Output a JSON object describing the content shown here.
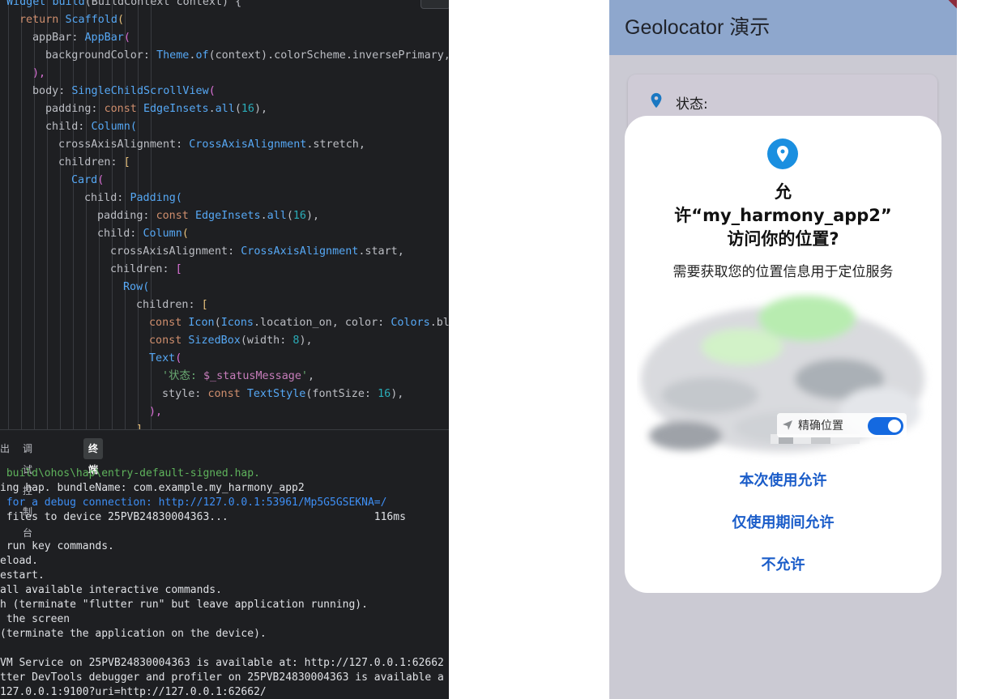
{
  "editor": {
    "lines": [
      [
        [
          "tok-cls",
          "Widget "
        ],
        [
          "tok-fn",
          "build"
        ],
        [
          "",
          "(BuildContext context) {"
        ]
      ],
      [
        [
          "tok-kw",
          "return "
        ],
        [
          "tok-cls",
          "Scaffold"
        ],
        [
          "tok-br1",
          "("
        ]
      ],
      [
        [
          "",
          "appBar: "
        ],
        [
          "tok-cls",
          "AppBar"
        ],
        [
          "tok-br2",
          "("
        ]
      ],
      [
        [
          "",
          "backgroundColor: "
        ],
        [
          "tok-cls",
          "Theme"
        ],
        [
          "",
          "."
        ],
        [
          "tok-fn",
          "of"
        ],
        [
          "",
          "(context).colorScheme.inversePrimary,"
        ]
      ],
      [
        [
          "tok-br2",
          "),"
        ]
      ],
      [
        [
          "",
          "body: "
        ],
        [
          "tok-cls",
          "SingleChildScrollView"
        ],
        [
          "tok-br2",
          "("
        ]
      ],
      [
        [
          "",
          "padding: "
        ],
        [
          "tok-kw",
          "const "
        ],
        [
          "tok-cls",
          "EdgeInsets"
        ],
        [
          "",
          "."
        ],
        [
          "tok-fn",
          "all"
        ],
        [
          "",
          "("
        ],
        [
          "tok-num",
          "16"
        ],
        [
          "",
          "),"
        ]
      ],
      [
        [
          "",
          "child: "
        ],
        [
          "tok-cls",
          "Column"
        ],
        [
          "tok-br3",
          "("
        ]
      ],
      [
        [
          "",
          "crossAxisAlignment: "
        ],
        [
          "tok-cls",
          "CrossAxisAlignment"
        ],
        [
          "",
          ".stretch,"
        ]
      ],
      [
        [
          "",
          "children: "
        ],
        [
          "tok-br1",
          "["
        ]
      ],
      [
        [
          "tok-cls",
          "Card"
        ],
        [
          "tok-br2",
          "("
        ]
      ],
      [
        [
          "",
          "child: "
        ],
        [
          "tok-cls",
          "Padding"
        ],
        [
          "tok-br3",
          "("
        ]
      ],
      [
        [
          "",
          "padding: "
        ],
        [
          "tok-kw",
          "const "
        ],
        [
          "tok-cls",
          "EdgeInsets"
        ],
        [
          "",
          "."
        ],
        [
          "tok-fn",
          "all"
        ],
        [
          "",
          "("
        ],
        [
          "tok-num",
          "16"
        ],
        [
          "",
          "),"
        ]
      ],
      [
        [
          "",
          "child: "
        ],
        [
          "tok-cls",
          "Column"
        ],
        [
          "tok-br1",
          "("
        ]
      ],
      [
        [
          "",
          "crossAxisAlignment: "
        ],
        [
          "tok-cls",
          "CrossAxisAlignment"
        ],
        [
          "",
          ".start,"
        ]
      ],
      [
        [
          "",
          "children: "
        ],
        [
          "tok-br2",
          "["
        ]
      ],
      [
        [
          "tok-cls",
          "Row"
        ],
        [
          "tok-br3",
          "("
        ]
      ],
      [
        [
          "",
          "children: "
        ],
        [
          "tok-br1",
          "["
        ]
      ],
      [
        [
          "tok-kw",
          "const "
        ],
        [
          "tok-cls",
          "Icon"
        ],
        [
          "",
          "("
        ],
        [
          "tok-cls",
          "Icons"
        ],
        [
          "",
          ".location_on, color: "
        ],
        [
          "tok-cls",
          "Colors"
        ],
        [
          "",
          ".blue"
        ]
      ],
      [
        [
          "tok-kw",
          "const "
        ],
        [
          "tok-cls",
          "SizedBox"
        ],
        [
          "",
          "(width: "
        ],
        [
          "tok-num",
          "8"
        ],
        [
          "",
          "),"
        ]
      ],
      [
        [
          "tok-cls",
          "Text"
        ],
        [
          "tok-br2",
          "("
        ]
      ],
      [
        [
          "tok-str",
          "'状态: "
        ],
        [
          "tok-var",
          "$_statusMessage"
        ],
        [
          "tok-str",
          "'"
        ],
        [
          "",
          ","
        ]
      ],
      [
        [
          "",
          "style: "
        ],
        [
          "tok-kw",
          "const "
        ],
        [
          "tok-cls",
          "TextStyle"
        ],
        [
          "",
          "(fontSize: "
        ],
        [
          "tok-num",
          "16"
        ],
        [
          "",
          "),"
        ]
      ],
      [
        [
          "tok-br2",
          "),"
        ]
      ],
      [
        [
          "tok-br1",
          "],"
        ]
      ]
    ]
  },
  "panel": {
    "tabs": [
      "出",
      "调试控制台",
      "终端"
    ],
    "active_tab": "终端",
    "terminal": [
      {
        "cls": "term-green",
        "text": " build\\ohos\\hap\\entry-default-signed.hap."
      },
      {
        "cls": "",
        "text": "ing hap. bundleName: com.example.my_harmony_app2"
      },
      {
        "cls": "term-blue",
        "text": " for a debug connection: http://127.0.0.1:53961/Mp5G5GSEKNA=/"
      },
      {
        "cls": "",
        "text": " files to device 25PVB24830004363...                       116ms"
      },
      {
        "cls": "",
        "text": ""
      },
      {
        "cls": "",
        "text": " run key commands."
      },
      {
        "cls": "",
        "text": "eload."
      },
      {
        "cls": "",
        "text": "estart."
      },
      {
        "cls": "",
        "text": "all available interactive commands."
      },
      {
        "cls": "",
        "text": "h (terminate \"flutter run\" but leave application running)."
      },
      {
        "cls": "",
        "text": " the screen"
      },
      {
        "cls": "",
        "text": "(terminate the application on the device)."
      },
      {
        "cls": "",
        "text": ""
      },
      {
        "cls": "",
        "text": "VM Service on 25PVB24830004363 is available at: http://127.0.0.1:62662"
      },
      {
        "cls": "",
        "text": "tter DevTools debugger and profiler on 25PVB24830004363 is available a"
      },
      {
        "cls": "",
        "text": "127.0.0.1:9100?uri=http://127.0.0.1:62662/"
      }
    ]
  },
  "phone": {
    "app_title": "Geolocator 演示",
    "status_label": "状态:",
    "dialog": {
      "title_lines": [
        "允",
        "许“my_harmony_app2”",
        "访问你的位置?"
      ],
      "description": "需要获取您的位置信息用于定位服务",
      "precise_label": "精确位置",
      "buttons": {
        "allow_once": "本次使用允许",
        "allow_while_using": "仅使用期间允许",
        "deny": "不允许"
      }
    }
  },
  "colors": {
    "ide_bg": "#1e1f22",
    "appbar": "#8ea7cd",
    "accent_blue": "#1b5dc9",
    "pin_blue": "#1a8fe0"
  }
}
